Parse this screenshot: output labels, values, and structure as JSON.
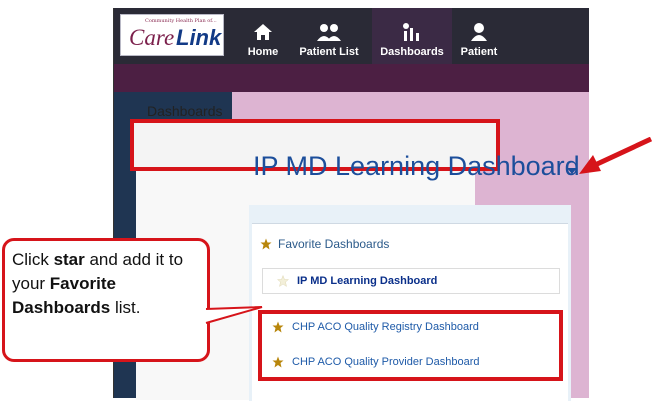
{
  "app": {
    "logo_tagline": "Community Health Plan of...",
    "logo_care": "Care",
    "logo_link": "Link"
  },
  "nav": {
    "items": [
      {
        "label": "Home",
        "icon": "home-icon"
      },
      {
        "label": "Patient List",
        "icon": "patients-icon"
      },
      {
        "label": "Dashboards",
        "icon": "dashboards-icon",
        "active": true
      },
      {
        "label": "Patient",
        "icon": "patient-icon"
      }
    ]
  },
  "page": {
    "title": "Dashboards",
    "dashboard_title": "IP MD Learning Dashboard"
  },
  "favorites": {
    "header": "Favorite Dashboards",
    "items": [
      {
        "label": "IP MD Learning Dashboard",
        "starred": false
      },
      {
        "label": "CHP ACO Quality Registry Dashboard",
        "starred": true
      },
      {
        "label": "CHP ACO Quality Provider Dashboard",
        "starred": true
      }
    ]
  },
  "callout": {
    "t1": "Click ",
    "b1": "star",
    "t2": " and add it to your ",
    "b2": "Favorite Dashboards",
    "t3": " list."
  },
  "colors": {
    "annotation_red": "#d6141a",
    "star_gold": "#b8860b",
    "title_blue": "#1c4e9b"
  }
}
